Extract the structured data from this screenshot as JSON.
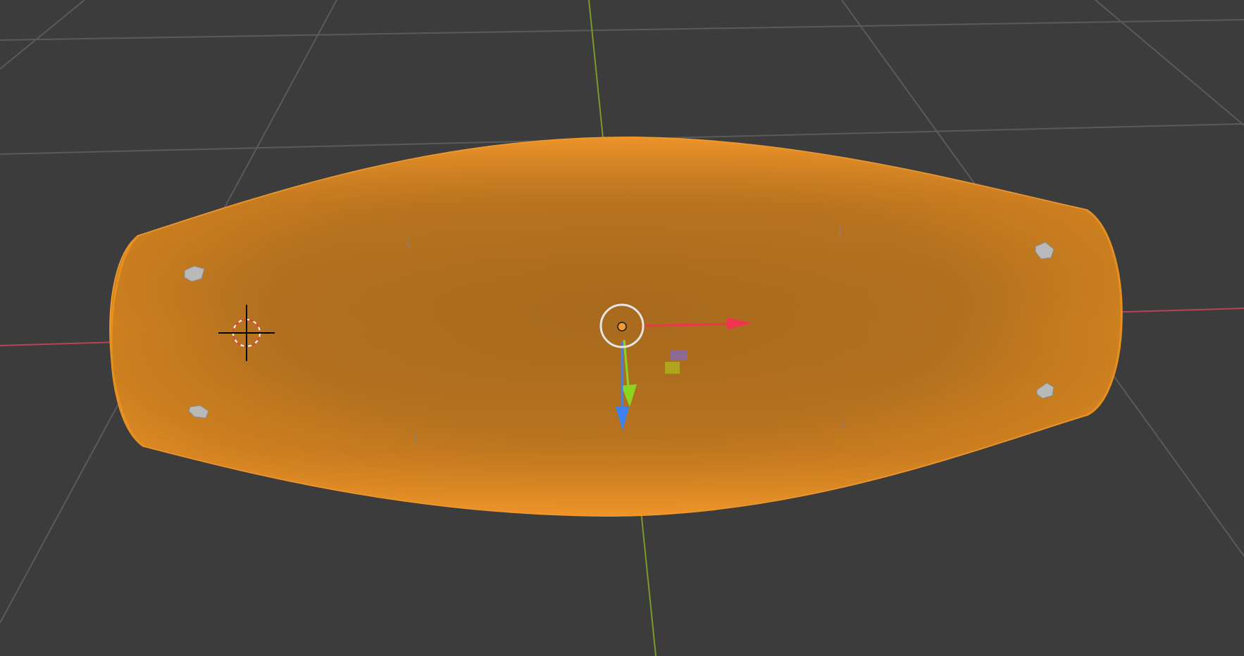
{
  "app": "3D viewport",
  "viewport": {
    "background_color": "#3c3c3c",
    "grid_color": "#5a5a5a",
    "x_axis_color": "#b5455a",
    "y_axis_color": "#7a9a2a"
  },
  "selected_object": {
    "shape": "barrel-shaped mesh",
    "selection_color": "#f0962a",
    "shading_center_color": "#a86a1e"
  },
  "gizmos": {
    "origin_icon": "object-origin-icon",
    "cursor_icon": "3d-cursor-icon",
    "move_x_icon": "move-x-arrow-icon",
    "move_y_icon": "move-y-arrow-icon",
    "move_z_icon": "move-z-arrow-icon",
    "plane_yz_icon": "plane-handle-icon",
    "plane_xz_icon": "plane-handle-icon",
    "x_color": "#f0344f",
    "y_color": "#8bd422",
    "z_color": "#3b82f0",
    "plane_purple": "#8a6aa0",
    "plane_yellow": "#b0a820"
  }
}
